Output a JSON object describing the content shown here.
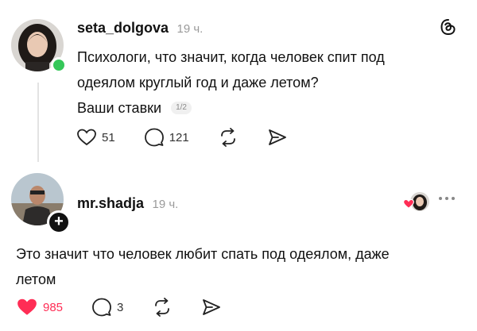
{
  "post": {
    "username": "seta_dolgova",
    "time": "19 ч.",
    "text_line1": "Психологи, что значит, когда человек спит под",
    "text_line2": "одеялом круглый год и даже летом?",
    "text_line3": "Ваши ставки",
    "page_indicator": "1/2",
    "likes": "51",
    "comments": "121"
  },
  "reply": {
    "username": "mr.shadja",
    "time": "19 ч.",
    "text_line1": "Это значит что человек любит спать под одеялом, даже",
    "text_line2": "летом",
    "likes": "985",
    "comments": "3"
  },
  "colors": {
    "online": "#35c759",
    "liked": "#ff2d55",
    "muted": "#9a9a9a"
  },
  "icons": {
    "app": "threads-logo-icon",
    "like": "heart-icon",
    "comment": "comment-icon",
    "repost": "repost-icon",
    "share": "send-icon",
    "more": "more-dots-icon"
  }
}
